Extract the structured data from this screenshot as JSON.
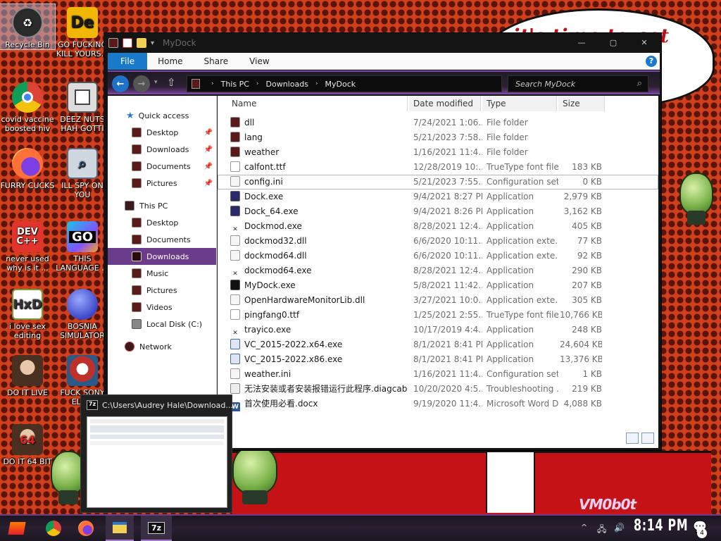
{
  "desktop": {
    "wallpaper_text": "...it's time to get hit... w",
    "wallpaper_brand": "VM0b0t",
    "icons": [
      {
        "label": "Recycle Bin",
        "icon": "recycle-bin-icon"
      },
      {
        "label": "GO FUCKING KILL YOURS...",
        "icon": "de-app-icon"
      },
      {
        "label": "covid vaccine boosted hiv ...",
        "icon": "chrome-icon"
      },
      {
        "label": "DEEZ NUTS HAH GOTTI",
        "icon": "stack-windows-icon"
      },
      {
        "label": "FURRY CUCKS",
        "icon": "firefox-icon"
      },
      {
        "label": "ILL SPY ON YOU",
        "icon": "network-spy-icon"
      },
      {
        "label": "never used why is it ...",
        "icon": "devcpp-icon"
      },
      {
        "label": "THIS LANGUAGE ...",
        "icon": "goland-icon"
      },
      {
        "label": "i love sex editing",
        "icon": "hxd-icon"
      },
      {
        "label": "BOSNIA SIMULATOR",
        "icon": "spiked-ball-icon"
      },
      {
        "label": "DO IT LIVE",
        "icon": "portrait-icon"
      },
      {
        "label": "FUCK SONY ELE...",
        "icon": "santa-icon"
      },
      {
        "label": "DO IT 64 BIT",
        "icon": "portrait-64-icon"
      }
    ]
  },
  "window": {
    "title": "MyDock",
    "ribbon_tabs": [
      "File",
      "Home",
      "Share",
      "View"
    ],
    "breadcrumb": [
      "This PC",
      "Downloads",
      "MyDock"
    ],
    "search_placeholder": "Search MyDock",
    "nav": {
      "quick_access": "Quick access",
      "quick_items": [
        "Desktop",
        "Downloads",
        "Documents",
        "Pictures"
      ],
      "this_pc": "This PC",
      "pc_items": [
        "Desktop",
        "Documents",
        "Downloads",
        "Music",
        "Pictures",
        "Videos",
        "Local Disk (C:)"
      ],
      "network": "Network"
    },
    "columns": {
      "name": "Name",
      "date": "Date modified",
      "type": "Type",
      "size": "Size"
    },
    "files": [
      {
        "name": "dll",
        "date": "7/24/2021 1:06...",
        "type": "File folder",
        "size": ""
      },
      {
        "name": "lang",
        "date": "5/21/2023 7:58...",
        "type": "File folder",
        "size": ""
      },
      {
        "name": "weather",
        "date": "1/16/2021 11:4...",
        "type": "File folder",
        "size": ""
      },
      {
        "name": "calfont.ttf",
        "date": "12/28/2019 10:...",
        "type": "TrueType font file",
        "size": "183 KB"
      },
      {
        "name": "config.ini",
        "date": "5/21/2023 7:55...",
        "type": "Configuration set...",
        "size": "0 KB"
      },
      {
        "name": "Dock.exe",
        "date": "9/4/2021 8:27 PM",
        "type": "Application",
        "size": "2,979 KB"
      },
      {
        "name": "Dock_64.exe",
        "date": "9/4/2021 8:26 PM",
        "type": "Application",
        "size": "3,162 KB"
      },
      {
        "name": "Dockmod.exe",
        "date": "8/28/2021 12:4...",
        "type": "Application",
        "size": "405 KB"
      },
      {
        "name": "dockmod32.dll",
        "date": "6/6/2020 10:11...",
        "type": "Application exte...",
        "size": "77 KB"
      },
      {
        "name": "dockmod64.dll",
        "date": "6/6/2020 10:11...",
        "type": "Application exte...",
        "size": "92 KB"
      },
      {
        "name": "dockmod64.exe",
        "date": "8/28/2021 12:4...",
        "type": "Application",
        "size": "290 KB"
      },
      {
        "name": "MyDock.exe",
        "date": "5/8/2021 11:42...",
        "type": "Application",
        "size": "207 KB"
      },
      {
        "name": "OpenHardwareMonitorLib.dll",
        "date": "3/27/2021 10:0...",
        "type": "Application exte...",
        "size": "305 KB"
      },
      {
        "name": "pingfang0.ttf",
        "date": "1/25/2021 2:55...",
        "type": "TrueType font file",
        "size": "10,766 KB"
      },
      {
        "name": "trayico.exe",
        "date": "10/17/2019 4:4...",
        "type": "Application",
        "size": "248 KB"
      },
      {
        "name": "VC_2015-2022.x64.exe",
        "date": "8/1/2021 8:41 PM",
        "type": "Application",
        "size": "24,604 KB"
      },
      {
        "name": "VC_2015-2022.x86.exe",
        "date": "8/1/2021 8:41 PM",
        "type": "Application",
        "size": "13,376 KB"
      },
      {
        "name": "weather.ini",
        "date": "1/16/2021 11:4...",
        "type": "Configuration set...",
        "size": "1 KB"
      },
      {
        "name": "无法安装或者安装报错运行此程序.diagcab",
        "date": "10/20/2020 4:5...",
        "type": "Troubleshooting ...",
        "size": "219 KB"
      },
      {
        "name": "首次使用必看.docx",
        "date": "9/19/2020 11:4...",
        "type": "Microsoft Word D...",
        "size": "4,088 KB"
      }
    ],
    "file_icons": [
      "folder-icon",
      "folder-icon",
      "folder-icon",
      "font-file-icon",
      "config-file-icon",
      "app-icon",
      "app-icon",
      "tools-icon",
      "dll-icon",
      "dll-icon",
      "tools-icon",
      "console-icon",
      "dll-icon",
      "font-file-icon",
      "tools-icon",
      "installer-icon",
      "installer-icon",
      "config-file-icon",
      "diagcab-icon",
      "word-doc-icon"
    ]
  },
  "thumbnail": {
    "app_label": "7z",
    "title": "C:\\Users\\Audrey Hale\\Download..."
  },
  "taskbar": {
    "pinned": [
      "start-button",
      "chrome-icon",
      "firefox-icon",
      "file-explorer-icon",
      "7zip-icon"
    ],
    "seven_zip_label": "7z",
    "clock": "8:14 PM",
    "notification_count": "4"
  },
  "colors": {
    "accent_purple": "#6a3c8a",
    "file_tab_blue": "#1979ca",
    "wallpaper_red": "#d0401c"
  }
}
